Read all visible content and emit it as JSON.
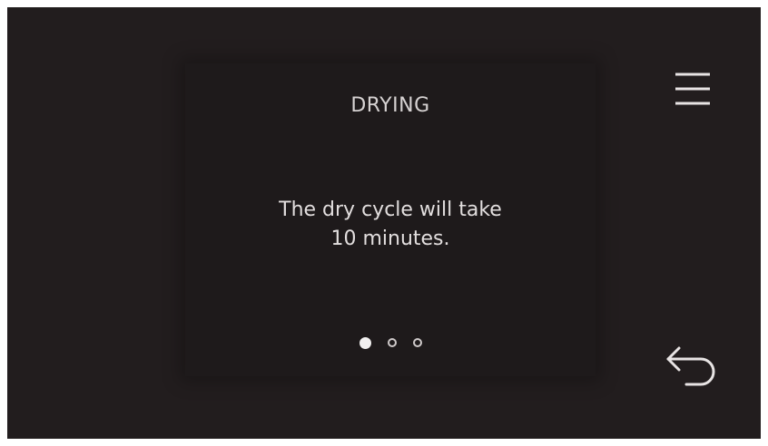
{
  "screen": {
    "title": "DRYING",
    "message_lines": [
      "The dry cycle will take",
      "10 minutes."
    ],
    "pager": {
      "total": 3,
      "active": 0
    }
  },
  "icons": {
    "menu": "hamburger-menu-icon",
    "back": "back-arrow-icon"
  },
  "colors": {
    "background": "#221d1e",
    "panel": "#1e1a1b",
    "text": "#e2dede"
  }
}
